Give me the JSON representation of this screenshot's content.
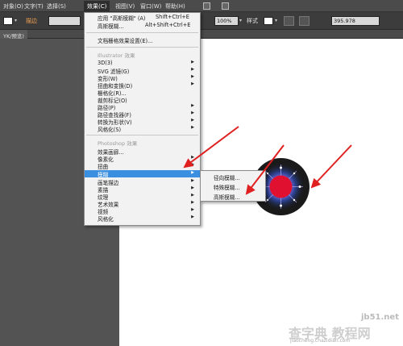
{
  "menubar": {
    "items": [
      "对象(O)",
      "文字(T)",
      "选择(S)",
      "效果(C)",
      "视图(V)",
      "窗口(W)",
      "帮助(H)"
    ]
  },
  "control_bar": {
    "stroke_label": "描边",
    "percent": "100%",
    "style_label": "样式",
    "coordinate": "395.978"
  },
  "doc_tab": {
    "label": "YK/预览)"
  },
  "effect_menu": {
    "top_items": [
      {
        "label": "应用 \"高斯模糊\" (A)",
        "shortcut": "Shift+Ctrl+E"
      },
      {
        "label": "高斯模糊...",
        "shortcut": "Alt+Shift+Ctrl+E"
      }
    ],
    "doc_raster": "文档栅格效果设置(E)...",
    "illustrator_header": "Illustrator 效果",
    "illustrator_items": [
      "3D(3)",
      "SVG 滤镜(G)",
      "变形(W)",
      "扭曲和变换(D)",
      "栅格化(R)...",
      "裁剪标记(O)",
      "路径(P)",
      "路径查找器(F)",
      "转换为形状(V)",
      "风格化(S)"
    ],
    "photoshop_header": "Photoshop 效果",
    "photoshop_items": [
      "效果画廊...",
      "像素化",
      "扭曲",
      "模糊",
      "画笔描边",
      "素描",
      "纹理",
      "艺术效果",
      "视频",
      "风格化"
    ],
    "highlighted": "模糊"
  },
  "blur_submenu": {
    "items": [
      "径向模糊...",
      "特殊模糊...",
      "高斯模糊..."
    ]
  },
  "watermark": {
    "main": "查字典 教程网",
    "site": "jb51.net",
    "url": "jiaocheng.chazidian.com"
  },
  "colors": {
    "highlight": "#3a8fe0",
    "arrow": "#e02020",
    "stroke_label": "#f0a050"
  }
}
